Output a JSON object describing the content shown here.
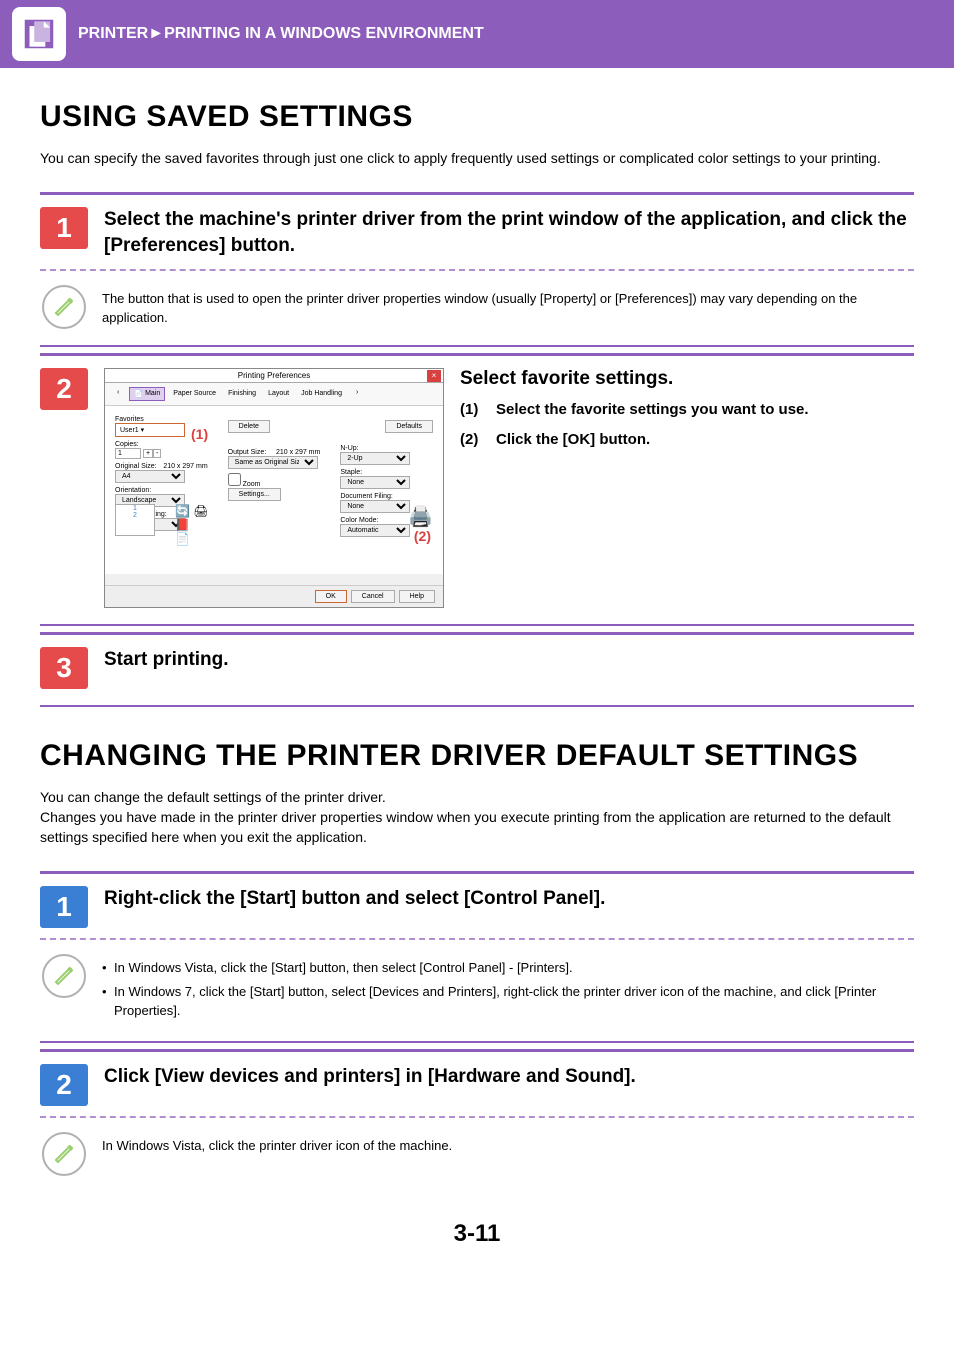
{
  "header": {
    "breadcrumb": "PRINTER►PRINTING IN A WINDOWS ENVIRONMENT"
  },
  "section1": {
    "title": "USING SAVED SETTINGS",
    "intro": "You can specify the saved favorites through just one click to apply frequently used settings or complicated color settings to your printing.",
    "step1": {
      "num": "1",
      "heading": "Select the machine's printer driver from the print window of the application, and click the [Preferences] button.",
      "note": "The button that is used to open the printer driver properties window (usually [Property] or [Preferences]) may vary depending on the application."
    },
    "step2": {
      "num": "2",
      "dialog": {
        "title": "Printing Preferences",
        "tabs": [
          "Main",
          "Paper Source",
          "Finishing",
          "Layout",
          "Job Handling"
        ],
        "favorites_label": "Favorites",
        "favorites_value": "User1",
        "delete_btn": "Delete",
        "defaults_btn": "Defaults",
        "copies_label": "Copies:",
        "copies_value": "1",
        "orig_label": "Original Size:",
        "orig_dim": "210 x 297 mm",
        "orig_value": "A4",
        "output_label": "Output Size:",
        "output_dim": "210 x 297 mm",
        "output_value": "Same as Original Size",
        "orient_label": "Orientation:",
        "orient_value": "Landscape",
        "zoom_label": "Zoom",
        "settings_btn": "Settings...",
        "twosided_label": "2-Sided Printing:",
        "twosided_value": "None",
        "nup_label": "N-Up:",
        "nup_value": "2-Up",
        "staple_label": "Staple:",
        "staple_value": "None",
        "docfiling_label": "Document Filing:",
        "docfiling_value": "None",
        "colormode_label": "Color Mode:",
        "colormode_value": "Automatic",
        "ok": "OK",
        "cancel": "Cancel",
        "help": "Help",
        "ann1": "(1)",
        "ann2": "(2)"
      },
      "side_heading": "Select favorite settings.",
      "side_items": [
        {
          "n": "(1)",
          "t": "Select the favorite settings you want to use."
        },
        {
          "n": "(2)",
          "t": "Click the [OK] button."
        }
      ]
    },
    "step3": {
      "num": "3",
      "heading": "Start printing."
    }
  },
  "section2": {
    "title": "CHANGING THE PRINTER DRIVER DEFAULT SETTINGS",
    "intro": "You can change the default settings of the printer driver.\nChanges you have made in the printer driver properties window when you execute printing from the application are returned to the default settings specified here when you exit the application.",
    "step1": {
      "num": "1",
      "heading": "Right-click the [Start] button and select [Control Panel].",
      "notes": [
        "In Windows Vista, click the [Start] button, then select [Control Panel] - [Printers].",
        "In Windows 7, click the [Start] button, select [Devices and Printers], right-click the printer driver icon of the machine, and click [Printer Properties]."
      ]
    },
    "step2": {
      "num": "2",
      "heading": "Click [View devices and printers] in [Hardware and Sound].",
      "note": "In Windows Vista, click the printer driver icon of the machine."
    }
  },
  "page_number": "3-11"
}
